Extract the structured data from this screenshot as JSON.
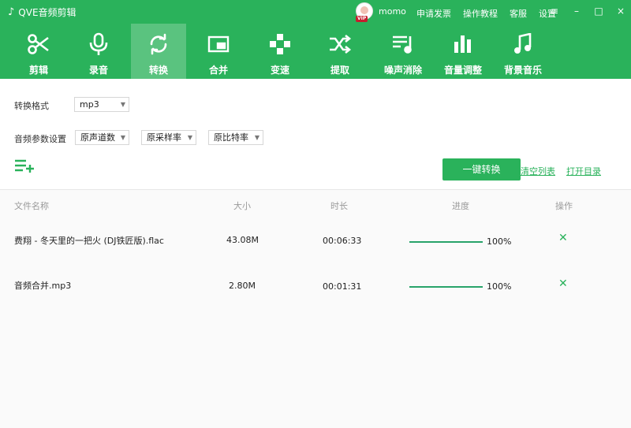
{
  "app": {
    "title": "QVE音频剪辑"
  },
  "user": {
    "name": "momo",
    "vip_badge": "VIP"
  },
  "top_links": [
    "申请发票",
    "操作教程",
    "客服",
    "设置"
  ],
  "window_controls": {
    "menu": "≡",
    "minimize": "–",
    "maximize": "□",
    "close": "×"
  },
  "toolbar": {
    "items": [
      {
        "label": "剪辑",
        "icon": "scissors-icon"
      },
      {
        "label": "录音",
        "icon": "microphone-icon"
      },
      {
        "label": "转换",
        "icon": "convert-icon",
        "active": true
      },
      {
        "label": "合并",
        "icon": "merge-icon"
      },
      {
        "label": "变速",
        "icon": "speed-icon"
      },
      {
        "label": "提取",
        "icon": "shuffle-icon"
      },
      {
        "label": "噪声消除",
        "icon": "noise-icon"
      },
      {
        "label": "音量调整",
        "icon": "volume-bars-icon"
      },
      {
        "label": "背景音乐",
        "icon": "music-note-icon"
      }
    ]
  },
  "settings": {
    "format_label": "转换格式",
    "format_value": "mp3",
    "params_label": "音频参数设置",
    "channels": "原声道数",
    "sample_rate": "原采样率",
    "bit_rate": "原比特率"
  },
  "actions": {
    "convert": "一键转换",
    "clear_list": "清空列表",
    "open_dir": "打开目录"
  },
  "table": {
    "headers": {
      "name": "文件名称",
      "size": "大小",
      "duration": "时长",
      "progress": "进度",
      "ops": "操作"
    },
    "rows": [
      {
        "name": "费翔 - 冬天里的一把火 (DJ铁匠版).flac",
        "size": "43.08M",
        "duration": "00:06:33",
        "progress": "100%"
      },
      {
        "name": "音频合并.mp3",
        "size": "2.80M",
        "duration": "00:01:31",
        "progress": "100%"
      }
    ]
  },
  "colors": {
    "brand": "#2ab25b",
    "active_tab": "#5ac37f",
    "progress": "#28a36a"
  }
}
